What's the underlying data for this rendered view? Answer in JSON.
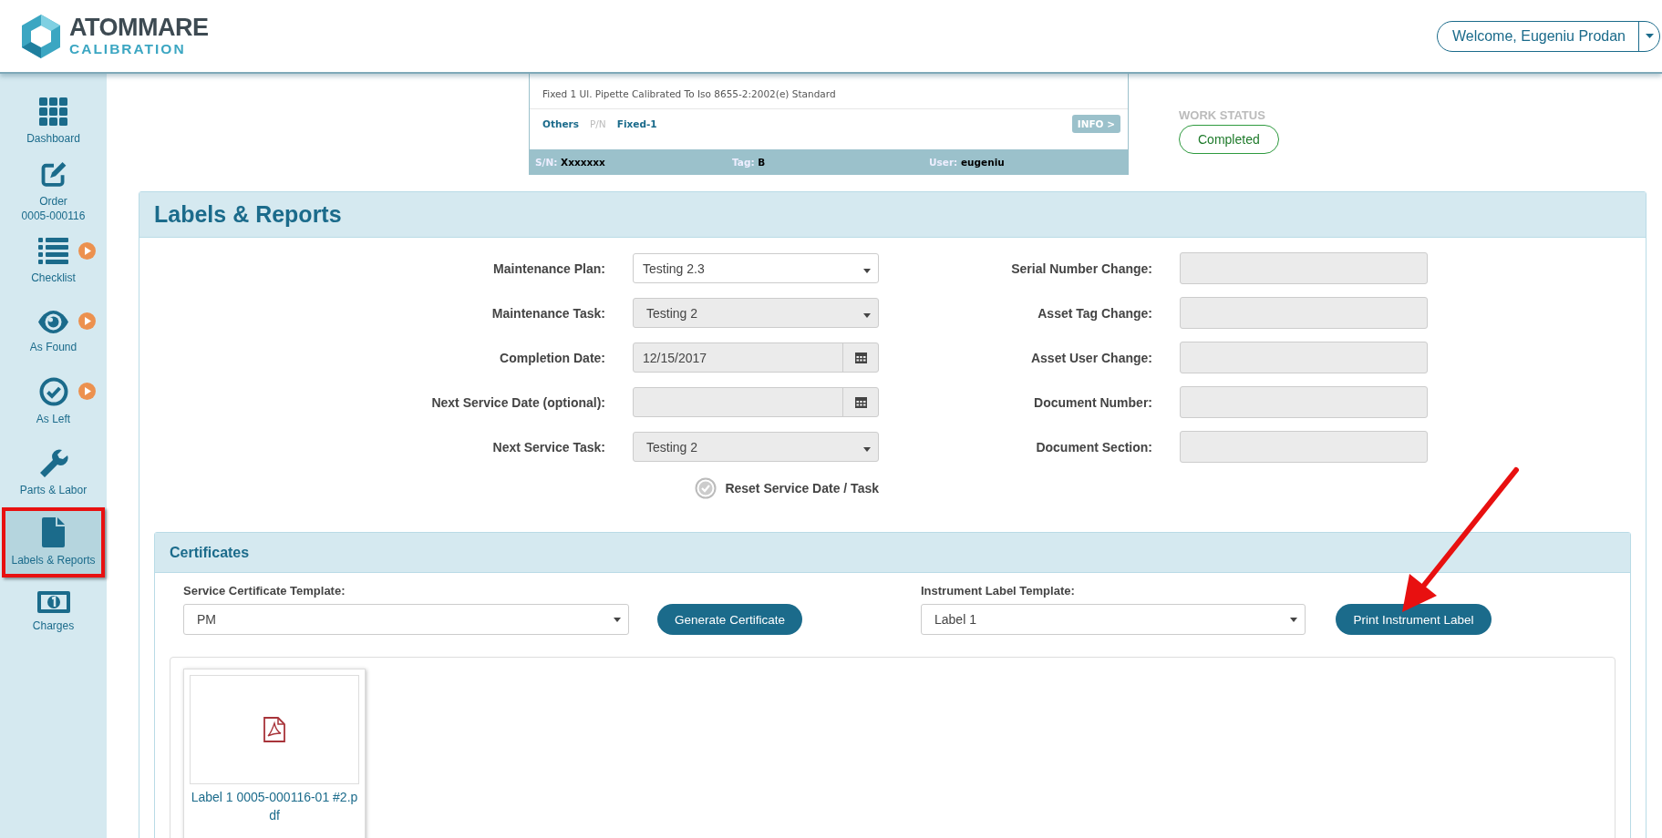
{
  "header": {
    "logo": {
      "name": "ATOMMARE",
      "subtitle": "CALIBRATION"
    },
    "user_menu": "Welcome, Eugeniu Prodan"
  },
  "sidebar": {
    "items": [
      {
        "kind": "grid",
        "label": "Dashboard",
        "selected": false,
        "indicator": false
      },
      {
        "kind": "edit",
        "label": "Order",
        "sublabel": "0005-000116",
        "selected": false,
        "indicator": false
      },
      {
        "kind": "list",
        "label": "Checklist",
        "selected": false,
        "indicator": true
      },
      {
        "kind": "eye",
        "label": "As Found",
        "selected": false,
        "indicator": true
      },
      {
        "kind": "check",
        "label": "As Left",
        "selected": false,
        "indicator": true
      },
      {
        "kind": "wrench",
        "label": "Parts & Labor",
        "selected": false,
        "indicator": false
      },
      {
        "kind": "file",
        "label": "Labels & Reports",
        "selected": true,
        "indicator": false
      },
      {
        "kind": "money",
        "label": "Charges",
        "selected": false,
        "indicator": false
      }
    ]
  },
  "instrument": {
    "description": "Fixed 1 Ul. Pipette Calibrated To Iso 8655-2:2002(e) Standard",
    "category": "Others",
    "pn_label": "P/N",
    "pn": "Fixed-1",
    "info_button": "INFO >",
    "fields": [
      {
        "label": "S/N:",
        "value": "Xxxxxxx"
      },
      {
        "label": "Tag:",
        "value": "B"
      },
      {
        "label": "User:",
        "value": "eugeniu"
      }
    ]
  },
  "work_status": {
    "label": "WORK STATUS",
    "value": "Completed"
  },
  "panel": {
    "title": "Labels & Reports",
    "left_fields": [
      {
        "label": "Maintenance Plan:",
        "kind": "select",
        "value": "Testing 2.3",
        "disabled": false
      },
      {
        "label": "Maintenance Task:",
        "kind": "select",
        "value": "Testing 2",
        "disabled": true
      },
      {
        "label": "Completion Date:",
        "kind": "date",
        "value": "12/15/2017",
        "disabled": true
      },
      {
        "label": "Next Service Date (optional):",
        "kind": "date",
        "disabled": true
      },
      {
        "label": "Next Service Task:",
        "kind": "select",
        "value": "Testing 2",
        "disabled": true
      }
    ],
    "right_fields": [
      {
        "label": "Serial Number Change:",
        "disabled": true
      },
      {
        "label": "Asset Tag Change:",
        "disabled": true
      },
      {
        "label": "Asset User Change:",
        "disabled": true
      },
      {
        "label": "Document Number:",
        "disabled": true
      },
      {
        "label": "Document Section:",
        "disabled": true
      }
    ],
    "reset": "Reset Service Date / Task"
  },
  "certificates": {
    "title": "Certificates",
    "service_template": {
      "label": "Service Certificate Template:",
      "value": "PM"
    },
    "generate_button": "Generate Certificate",
    "label_template": {
      "label": "Instrument Label Template:",
      "value": "Label 1"
    },
    "print_button": "Print Instrument Label",
    "files": [
      {
        "name": "Label 1 0005-000116-01 #2.pdf"
      }
    ]
  }
}
